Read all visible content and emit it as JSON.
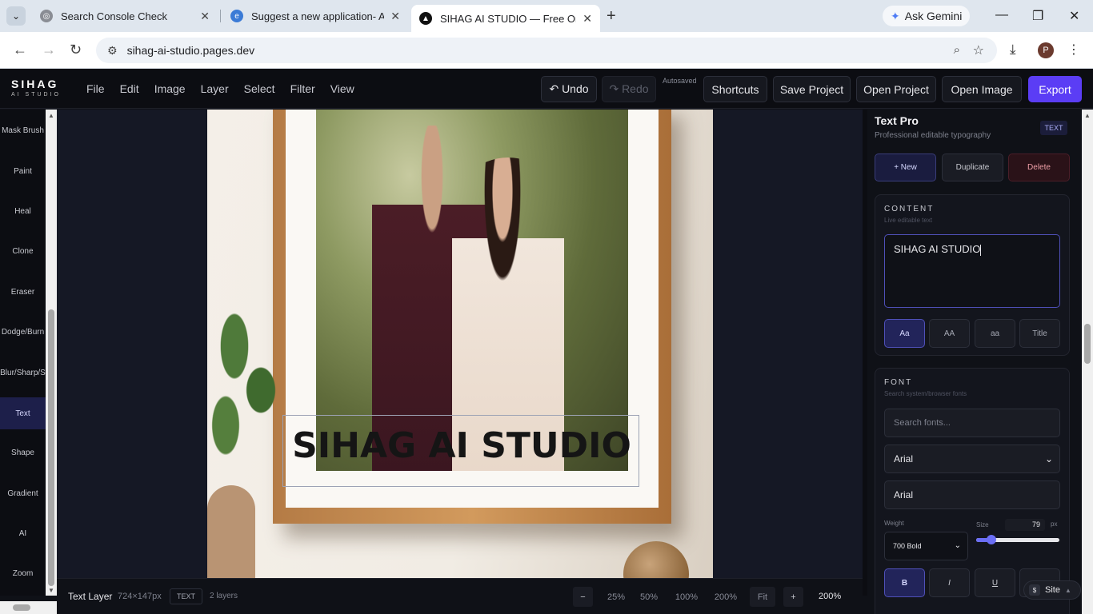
{
  "browser": {
    "tabs": [
      {
        "title": "Search Console Check",
        "active": false
      },
      {
        "title": "Suggest a new application- Alte",
        "active": false
      },
      {
        "title": "SIHAG AI STUDIO — Free Onlin",
        "active": true
      }
    ],
    "gemini_label": "Ask Gemini",
    "url": "sihag-ai-studio.pages.dev",
    "profile_initial": "P"
  },
  "app": {
    "logo_main": "SIHAG",
    "logo_sub": "AI STUDIO",
    "menu": [
      "File",
      "Edit",
      "Image",
      "Layer",
      "Select",
      "Filter",
      "View"
    ],
    "undo_label": "↶ Undo",
    "redo_label": "↷ Redo",
    "autosaved": "Autosaved",
    "shortcuts_label": "Shortcuts",
    "save_project_label": "Save Project",
    "open_project_label": "Open Project",
    "open_image_label": "Open Image",
    "export_label": "Export"
  },
  "tools": [
    "Mask Brush",
    "Paint",
    "Heal",
    "Clone",
    "Eraser",
    "Dodge/Burn",
    "Blur/Sharp/S",
    "Text",
    "Shape",
    "Gradient",
    "AI",
    "Zoom"
  ],
  "active_tool": "Text",
  "canvas": {
    "text_layer": "SIHAG AI STUDIO"
  },
  "status": {
    "layer_label": "Text Layer",
    "dimensions": "724×147px",
    "badge": "TEXT",
    "layers": "2 layers",
    "zoom_minus": "−",
    "zoom_presets": [
      "25%",
      "50%",
      "100%",
      "200%"
    ],
    "fit": "Fit",
    "zoom_plus": "+",
    "zoom_current": "200%"
  },
  "panel": {
    "title": "Text Pro",
    "subtitle": "Professional editable typography",
    "badge": "TEXT",
    "new_label": "+ New",
    "duplicate_label": "Duplicate",
    "delete_label": "Delete",
    "content": {
      "heading": "CONTENT",
      "sub": "Live editable text",
      "value": "SIHAG AI STUDIO",
      "case_options": [
        "Aa",
        "AA",
        "aa",
        "Title"
      ]
    },
    "font": {
      "heading": "FONT",
      "sub": "Search system/browser fonts",
      "search_placeholder": "Search fonts...",
      "family_selected": "Arial",
      "family_input": "Arial",
      "weight_label": "Weight",
      "weight_value": "700 Bold",
      "size_label": "Size",
      "size_value": "79",
      "size_unit": "px",
      "size_slider_fraction": 0.18,
      "style_buttons": [
        "B",
        "I",
        "U",
        ""
      ]
    },
    "site_label": "Site"
  }
}
